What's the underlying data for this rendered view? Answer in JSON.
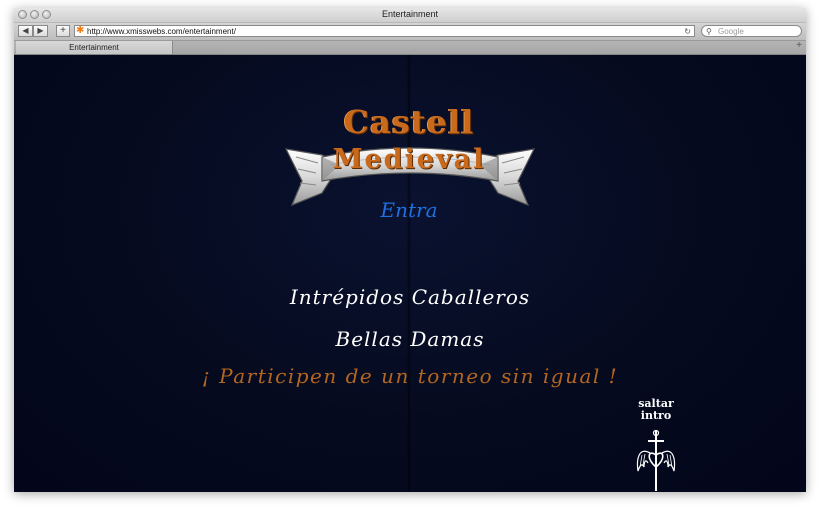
{
  "window": {
    "title": "Entertainment"
  },
  "toolbar": {
    "back_label": "◀",
    "forward_label": "▶",
    "add_label": "+",
    "url": "http://www.xmisswebs.com/entertainment/",
    "reload_label": "↻",
    "search_placeholder": "Google"
  },
  "tabs": [
    {
      "label": "Entertainment"
    }
  ],
  "page": {
    "logo_top": "Castell",
    "logo_bottom": "Medieval",
    "enter_link": "Entra",
    "line1": "Intrépidos Caballeros",
    "line2": "Bellas Damas",
    "line3": "¡ Participen de un torneo sin igual !",
    "skip_line1": "saltar",
    "skip_line2": "intro"
  },
  "colors": {
    "background": "#050a1e",
    "logo": "#c8691c",
    "enter": "#1e6fe0",
    "invite": "#b3661f"
  }
}
